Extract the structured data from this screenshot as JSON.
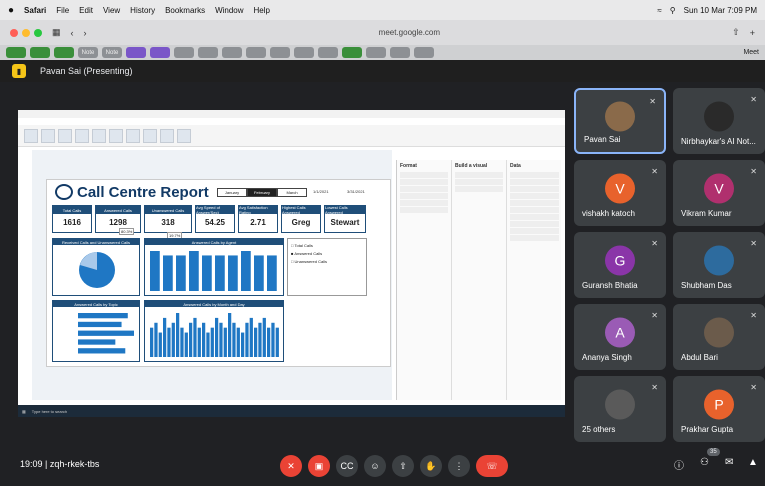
{
  "menubar": {
    "app": "Safari",
    "items": [
      "File",
      "Edit",
      "View",
      "History",
      "Bookmarks",
      "Window",
      "Help"
    ],
    "clock": "Sun 10 Mar  7:09 PM"
  },
  "browser": {
    "url": "meet.google.com"
  },
  "tabs": {
    "labels": [
      "",
      "",
      "",
      "Note",
      "Note",
      "",
      "",
      "",
      "",
      "",
      "",
      "",
      "",
      "",
      "",
      "",
      "",
      ""
    ],
    "active": "Meet"
  },
  "presenting": {
    "label": "Pavan Sai (Presenting)"
  },
  "report": {
    "title": "Call Centre Report",
    "months": [
      "January",
      "February",
      "March"
    ],
    "dates": [
      "1/1/2021",
      "3/31/2021"
    ],
    "kpis": [
      {
        "label": "Total Calls",
        "value": "1616"
      },
      {
        "label": "Answered Calls",
        "value": "1298"
      },
      {
        "label": "Unanswered Calls",
        "value": "318"
      },
      {
        "label": "Avg Speed of Answer(Sec)",
        "value": "54.25"
      },
      {
        "label": "Avg Satisfaction Rating",
        "value": "2.71"
      },
      {
        "label": "Highest Calls Answered",
        "value": "Greg"
      },
      {
        "label": "Lowest Calls Answered",
        "value": "Stewart"
      }
    ],
    "pct_answered": "80.3%",
    "pct_unanswered": "19.7%",
    "panel1": "Received Calls and Unanswered Calls",
    "panel2": "Answered Calls by Agent",
    "panel3": "Answered Calls by Topic",
    "panel4": "Answered Calls by Month and Day",
    "legend": [
      "Total Calls",
      "Answered Calls",
      "Unanswered Calls"
    ]
  },
  "chart_data": [
    {
      "type": "bar",
      "title": "Answered Calls by Agent",
      "values": [
        9,
        8,
        8,
        9,
        8,
        8,
        8,
        9,
        8,
        8
      ]
    },
    {
      "type": "bar",
      "title": "Answered Calls by Month and Day",
      "values": [
        6,
        7,
        5,
        8,
        6,
        7,
        9,
        6,
        5,
        7,
        8,
        6,
        7,
        5,
        6,
        8,
        7,
        6,
        9,
        7,
        6,
        5,
        7,
        8,
        6,
        7,
        8,
        6,
        7,
        6
      ]
    },
    {
      "type": "bar",
      "title": "Answered Calls by Topic",
      "values": [
        40,
        35,
        45,
        30,
        38
      ]
    }
  ],
  "pbi_side": {
    "format": "Format",
    "visual": "Build a visual",
    "data": "Data",
    "filters": "Filters"
  },
  "taskbar": {
    "search": "Type here to search"
  },
  "participants": [
    {
      "name": "Pavan Sai",
      "initial": "",
      "color": "#8a6a4a"
    },
    {
      "name": "Nirbhaykar's AI Not...",
      "initial": "",
      "color": "#2a2a2a"
    },
    {
      "name": "vishakh katoch",
      "initial": "V",
      "color": "#e8622c"
    },
    {
      "name": "Vikram Kumar",
      "initial": "V",
      "color": "#b0306e"
    },
    {
      "name": "Guransh Bhatia",
      "initial": "G",
      "color": "#8a35a8"
    },
    {
      "name": "Shubham Das",
      "initial": "",
      "color": "#2d6b9e"
    },
    {
      "name": "Ananya Singh",
      "initial": "A",
      "color": "#9a5bb5"
    },
    {
      "name": "Abdul Bari",
      "initial": "",
      "color": "#6b5b4b"
    },
    {
      "name": "25 others",
      "initial": "",
      "color": "#5a5a5a"
    },
    {
      "name": "Prakhar Gupta",
      "initial": "P",
      "color": "#e8622c"
    }
  ],
  "meeting": {
    "time": "19:09",
    "code": "zqh-rkek-tbs",
    "count": "35"
  }
}
